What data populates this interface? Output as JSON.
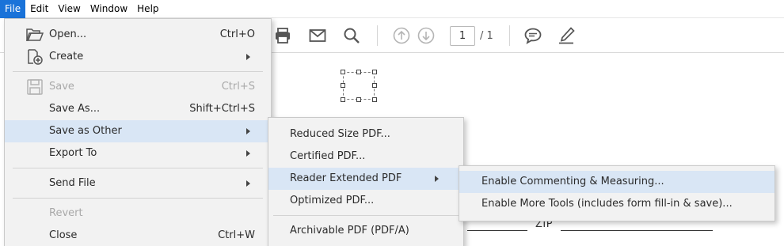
{
  "menubar": {
    "items": [
      "File",
      "Edit",
      "View",
      "Window",
      "Help"
    ],
    "active": "File",
    "active_color": "#1a73d9"
  },
  "toolbar": {
    "icons": [
      "print-icon",
      "mail-icon",
      "search-icon",
      "page-up-icon",
      "page-down-icon",
      "comment-icon",
      "sign-icon"
    ],
    "page_current": "1",
    "page_total": "/ 1"
  },
  "document": {
    "zip_label": "ZIP"
  },
  "file_menu": {
    "items": [
      {
        "label": "Open...",
        "shortcut": "Ctrl+O",
        "icon": "folder-open-icon"
      },
      {
        "label": "Create",
        "shortcut": "",
        "icon": "create-icon",
        "submenu": true
      },
      {
        "label": "Save",
        "shortcut": "Ctrl+S",
        "icon": "save-icon",
        "disabled": true
      },
      {
        "label": "Save As...",
        "shortcut": "Shift+Ctrl+S"
      },
      {
        "label": "Save as Other",
        "shortcut": "",
        "submenu": true,
        "highlighted": true
      },
      {
        "label": "Export To",
        "shortcut": "",
        "submenu": true
      },
      {
        "label": "Send File",
        "shortcut": "",
        "submenu": true
      },
      {
        "label": "Revert",
        "shortcut": "",
        "disabled": true
      },
      {
        "label": "Close",
        "shortcut": "Ctrl+W"
      }
    ]
  },
  "save_as_other_menu": {
    "items": [
      {
        "label": "Reduced Size PDF..."
      },
      {
        "label": "Certified PDF..."
      },
      {
        "label": "Reader Extended PDF",
        "submenu": true,
        "highlighted": true
      },
      {
        "label": "Optimized PDF..."
      },
      {
        "label": "Archivable PDF (PDF/A)"
      }
    ]
  },
  "reader_extended_menu": {
    "items": [
      {
        "label": "Enable Commenting & Measuring...",
        "highlighted": true
      },
      {
        "label": "Enable More Tools (includes form fill-in & save)..."
      }
    ]
  },
  "colors": {
    "highlight": "#d9e6f5",
    "menu_bg": "#f2f2f2",
    "disabled_text": "#a9a9a9"
  }
}
